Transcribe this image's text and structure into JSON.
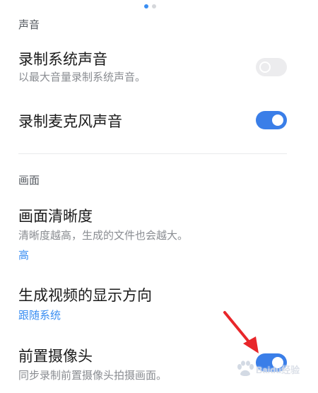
{
  "sections": [
    {
      "header": "声音",
      "rows": [
        {
          "title": "录制系统声音",
          "subtitle": "以最大音量录制系统声音。",
          "toggle": false
        },
        {
          "title": "录制麦克风声音",
          "toggle": true
        }
      ]
    },
    {
      "header": "画面",
      "rows": [
        {
          "title": "画面清晰度",
          "subtitle": "清晰度越高，生成的文件也会越大。",
          "value": "高"
        },
        {
          "title": "生成视频的显示方向",
          "value": "跟随系统"
        },
        {
          "title": "前置摄像头",
          "subtitle": "同步录制前置摄像头拍摄画面。",
          "toggle": true
        }
      ]
    }
  ],
  "pager": {
    "count": 2,
    "active": 0
  },
  "watermark": {
    "text": "Baidu经验",
    "icon": "baidu-paw-icon"
  },
  "annotation": {
    "icon": "red-arrow-icon",
    "color": "#e8262a"
  },
  "colors": {
    "accent": "#3a8ef2",
    "toggle_on": "#3a7ee8",
    "toggle_off": "#ececee"
  }
}
